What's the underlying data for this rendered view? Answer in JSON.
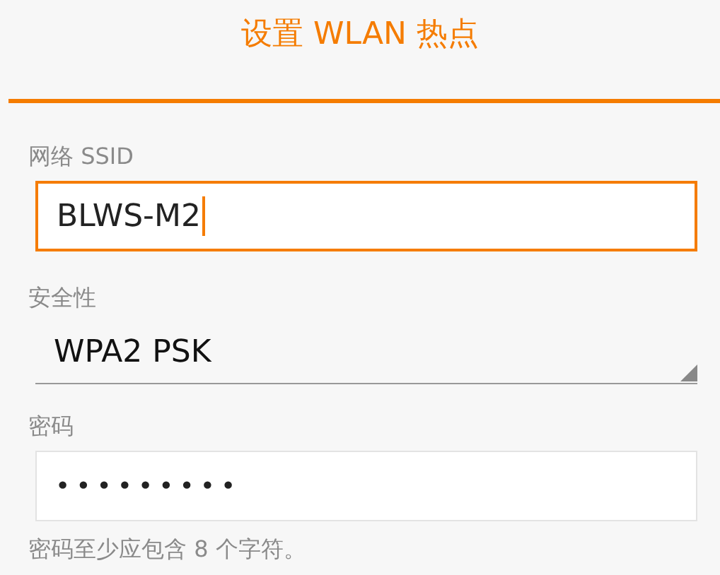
{
  "title": "设置 WLAN 热点",
  "fields": [
    {
      "kind": "text",
      "label": "网络 SSID",
      "value": "BLWS-M2",
      "focused": true
    },
    {
      "kind": "select",
      "label": "安全性",
      "value": "WPA2 PSK"
    },
    {
      "kind": "password",
      "label": "密码",
      "value": "•••••••••",
      "focused": false
    }
  ],
  "hint": "密码至少应包含 8 个字符。"
}
